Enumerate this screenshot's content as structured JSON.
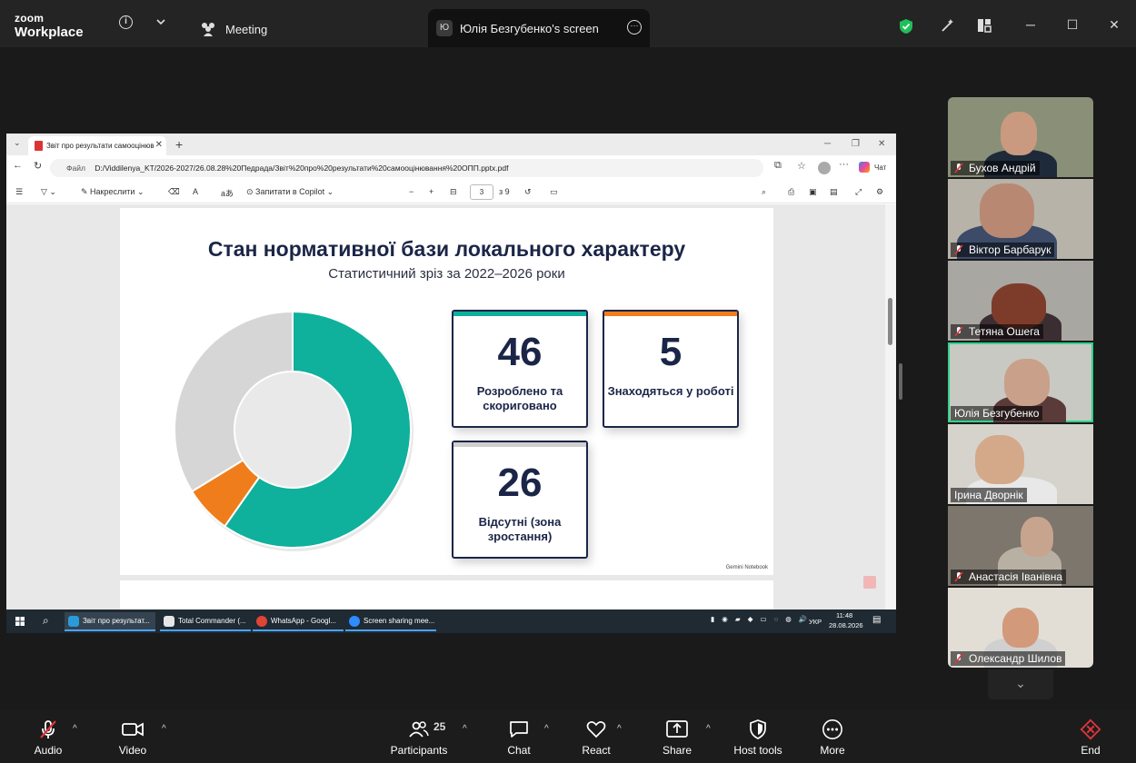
{
  "app": {
    "logo_line1": "zoom",
    "logo_line2": "Workplace",
    "meeting_tab": "Meeting",
    "screen_tab": "Юлія Безгубенко's screen",
    "screen_tab_initial": "Ю",
    "shield_color": "#1fbf5a"
  },
  "browser": {
    "tab_title": "Звіт про результати самооцінюв",
    "address_prefix": "Файл",
    "address": "D:/Viddilenya_KT/2026-2027/26.08.28%20Педрада/Звіт%20про%20результати%20самооцінювання%20ОПП.pptx.pdf",
    "chat_label": "Чат",
    "draw_label": "Накреслити",
    "copilot_label": "Запитати в Copilot",
    "page_current": "3",
    "page_total": "з 9"
  },
  "slide": {
    "title": "Стан нормативної бази локального характеру",
    "subtitle": "Статистичний зріз за 2022–2026 роки",
    "watermark": "Gemini Notebook",
    "cards": [
      {
        "value": "46",
        "label": "Розроблено та скориговано",
        "bar_color": "#0fb09c"
      },
      {
        "value": "5",
        "label": "Знаходяться у роботі",
        "bar_color": "#ef7d1c"
      },
      {
        "value": "26",
        "label": "Відсутні (зона зростання)",
        "bar_color": "#cfcfcf"
      }
    ]
  },
  "chart_data": {
    "type": "pie",
    "categories": [
      "Розроблено та скориговано",
      "Знаходяться у роботі",
      "Відсутні (зона зростання)"
    ],
    "values": [
      46,
      5,
      26
    ],
    "colors": [
      "#0fb09c",
      "#ef7d1c",
      "#d6d6d6"
    ],
    "donut": true
  },
  "taskbar": {
    "apps": [
      "Звіт про результат...",
      "Total Commander (...",
      "WhatsApp - Googl...",
      "Screen sharing mee..."
    ],
    "lang": "УКР",
    "time": "11:48",
    "date": "28.08.2026"
  },
  "participants": [
    {
      "name": "Бухов Андрій",
      "muted": true
    },
    {
      "name": "Віктор Барбарук",
      "muted": true
    },
    {
      "name": "Тетяна Ошега",
      "muted": true
    },
    {
      "name": "Юлія Безгубенко",
      "muted": false
    },
    {
      "name": "Ірина Дворнік",
      "muted": false
    },
    {
      "name": "Анастасія Іванівна",
      "muted": true
    },
    {
      "name": "Олександр Шилов",
      "muted": true
    }
  ],
  "toolbar": {
    "audio": "Audio",
    "video": "Video",
    "participants": "Participants",
    "participant_count": "25",
    "chat": "Chat",
    "react": "React",
    "share": "Share",
    "host_tools": "Host tools",
    "more": "More",
    "end": "End"
  }
}
